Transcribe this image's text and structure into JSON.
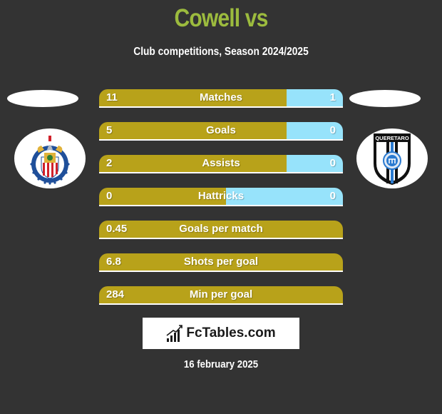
{
  "header": {
    "title": "Cowell vs",
    "subtitle": "Club competitions, Season 2024/2025"
  },
  "teams": {
    "left": {
      "logo": "chivas-guadalajara-crest-icon"
    },
    "right": {
      "logo": "queretaro-crest-icon",
      "logo_text": "QUERETARO"
    }
  },
  "stats": [
    {
      "label": "Matches",
      "left": "11",
      "right": "1",
      "left_share": 0.77
    },
    {
      "label": "Goals",
      "left": "5",
      "right": "0",
      "left_share": 0.77
    },
    {
      "label": "Assists",
      "left": "2",
      "right": "0",
      "left_share": 0.77
    },
    {
      "label": "Hattricks",
      "left": "0",
      "right": "0",
      "left_share": 0.52
    },
    {
      "label": "Goals per match",
      "left": "0.45"
    },
    {
      "label": "Shots per goal",
      "left": "6.8"
    },
    {
      "label": "Min per goal",
      "left": "284"
    }
  ],
  "colors": {
    "background": "#333333",
    "title": "#9cbb3e",
    "left_bar": "#b8a21a",
    "right_bar": "#97e3fb"
  },
  "brand": {
    "text": "FcTables.com"
  },
  "footer": {
    "date": "16 february 2025"
  }
}
